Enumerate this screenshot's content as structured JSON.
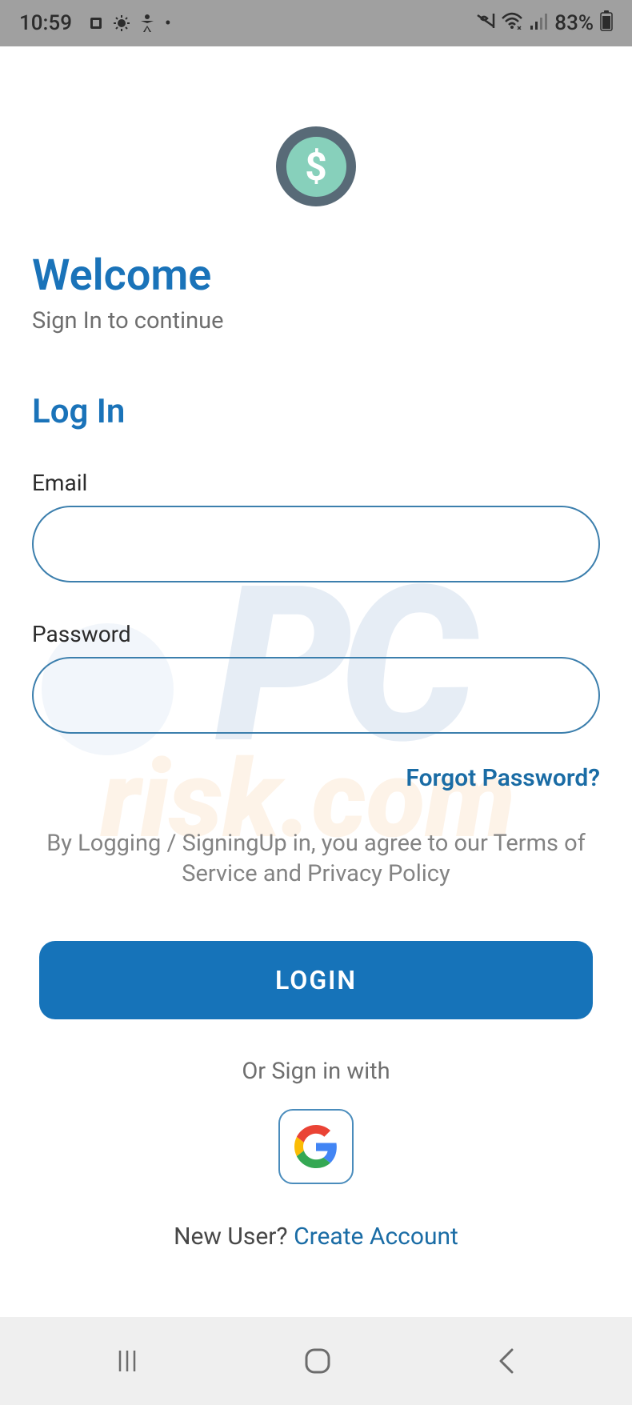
{
  "status": {
    "time": "10:59",
    "battery": "83%"
  },
  "header": {
    "title": "Welcome",
    "subtitle": "Sign In to continue"
  },
  "form": {
    "heading": "Log In",
    "email_label": "Email",
    "password_label": "Password",
    "forgot_password": "Forgot Password?",
    "terms": "By Logging / SigningUp in, you agree to our Terms of Service and Privacy Policy",
    "login_button": "LOGIN",
    "alt_signin": "Or Sign in with"
  },
  "footer": {
    "new_user": "New User?  ",
    "create_account": "Create Account"
  }
}
